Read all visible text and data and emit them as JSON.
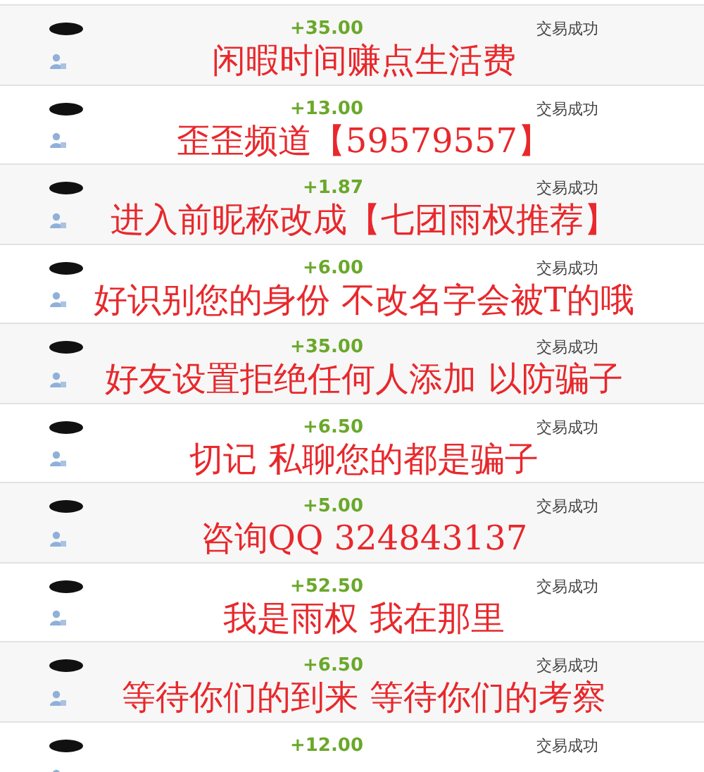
{
  "transactions": [
    {
      "amount": "+35.00",
      "status": "交易成功",
      "overlay": "闲暇时间赚点生活费"
    },
    {
      "amount": "+13.00",
      "status": "交易成功",
      "overlay": "歪歪频道【59579557】"
    },
    {
      "amount": "+1.87",
      "status": "交易成功",
      "overlay": "进入前昵称改成【七团雨权推荐】"
    },
    {
      "amount": "+6.00",
      "status": "交易成功",
      "overlay": "好识别您的身份 不改名字会被T的哦"
    },
    {
      "amount": "+35.00",
      "status": "交易成功",
      "overlay": "好友设置拒绝任何人添加 以防骗子"
    },
    {
      "amount": "+6.50",
      "status": "交易成功",
      "overlay": "切记 私聊您的都是骗子"
    },
    {
      "amount": "+5.00",
      "status": "交易成功",
      "overlay": "咨询QQ 324843137"
    },
    {
      "amount": "+52.50",
      "status": "交易成功",
      "overlay": "我是雨权 我在那里"
    },
    {
      "amount": "+6.50",
      "status": "交易成功",
      "overlay": "等待你们的到来 等待你们的考察"
    },
    {
      "amount": "+12.00",
      "status": "交易成功"
    }
  ]
}
